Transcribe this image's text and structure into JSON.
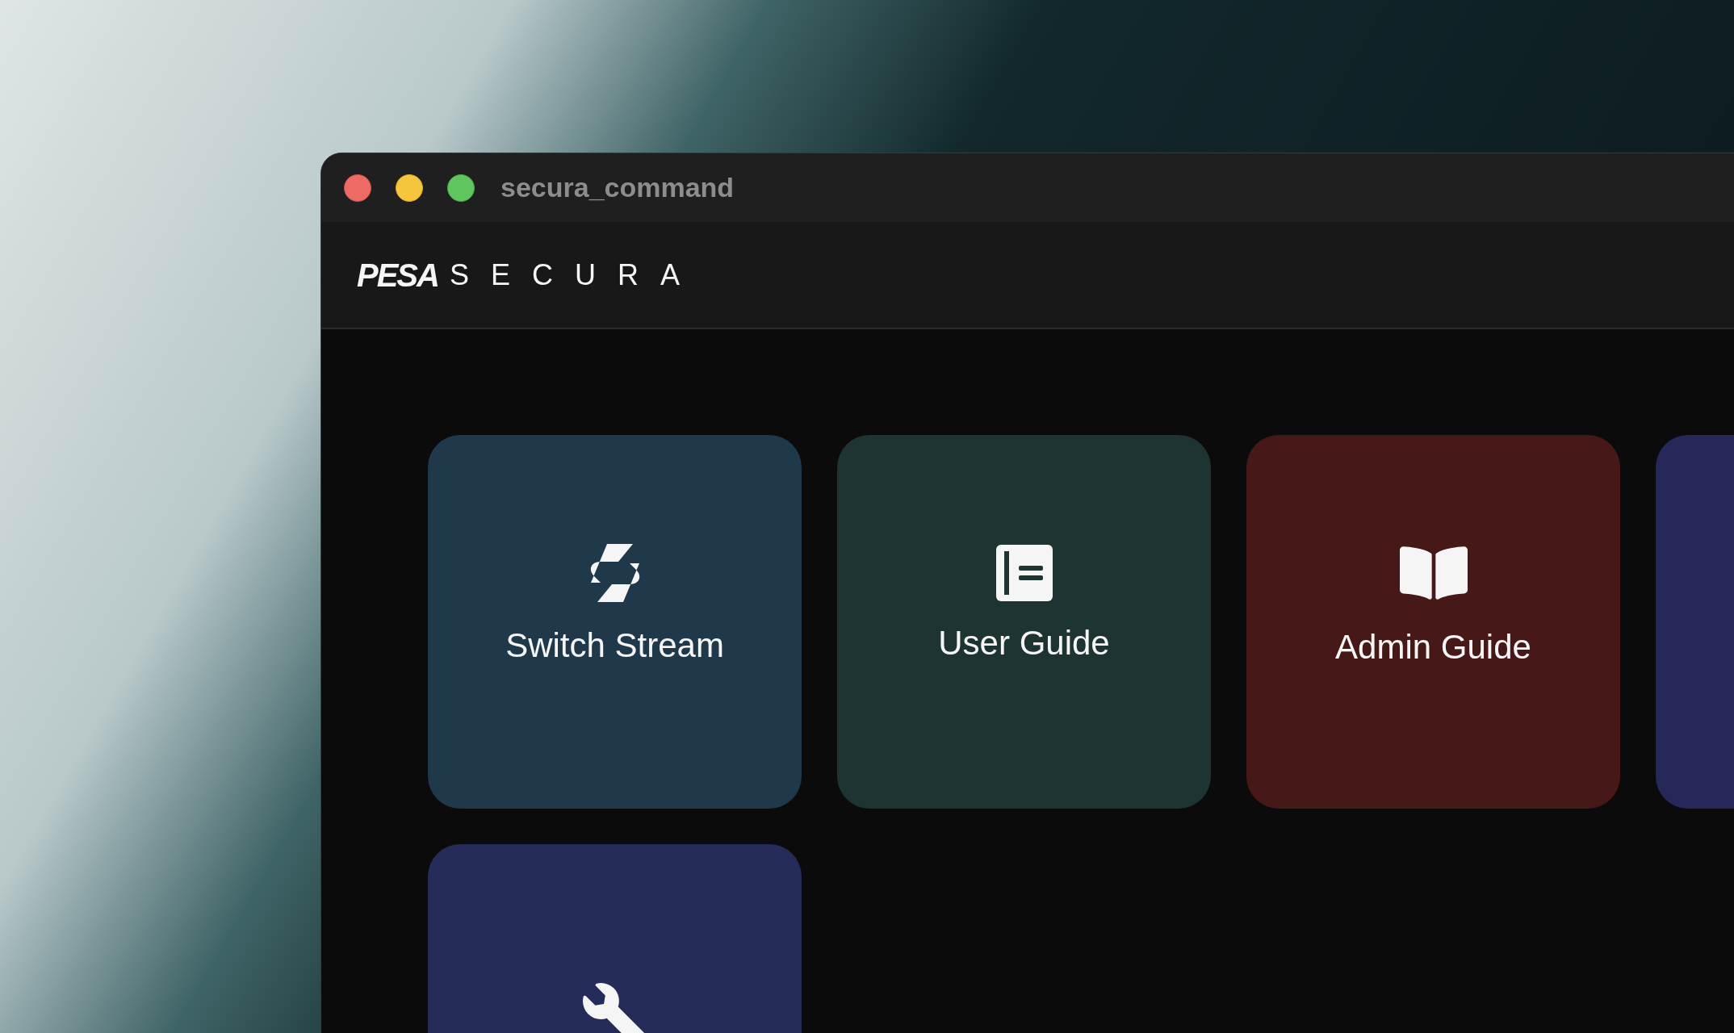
{
  "window": {
    "title": "secura_command"
  },
  "logo": {
    "mark": "PESA",
    "name": "SECURA"
  },
  "tiles": [
    {
      "kind": "stream",
      "label": "Switch Stream",
      "color": "#1f394a"
    },
    {
      "kind": "document",
      "label": "User Guide",
      "color": "#1d3432"
    },
    {
      "kind": "book",
      "label": "Admin Guide",
      "color": "#461918"
    },
    {
      "kind": "blank",
      "color": "#262859"
    },
    {
      "kind": "wrench",
      "color": "#252c5a"
    }
  ]
}
